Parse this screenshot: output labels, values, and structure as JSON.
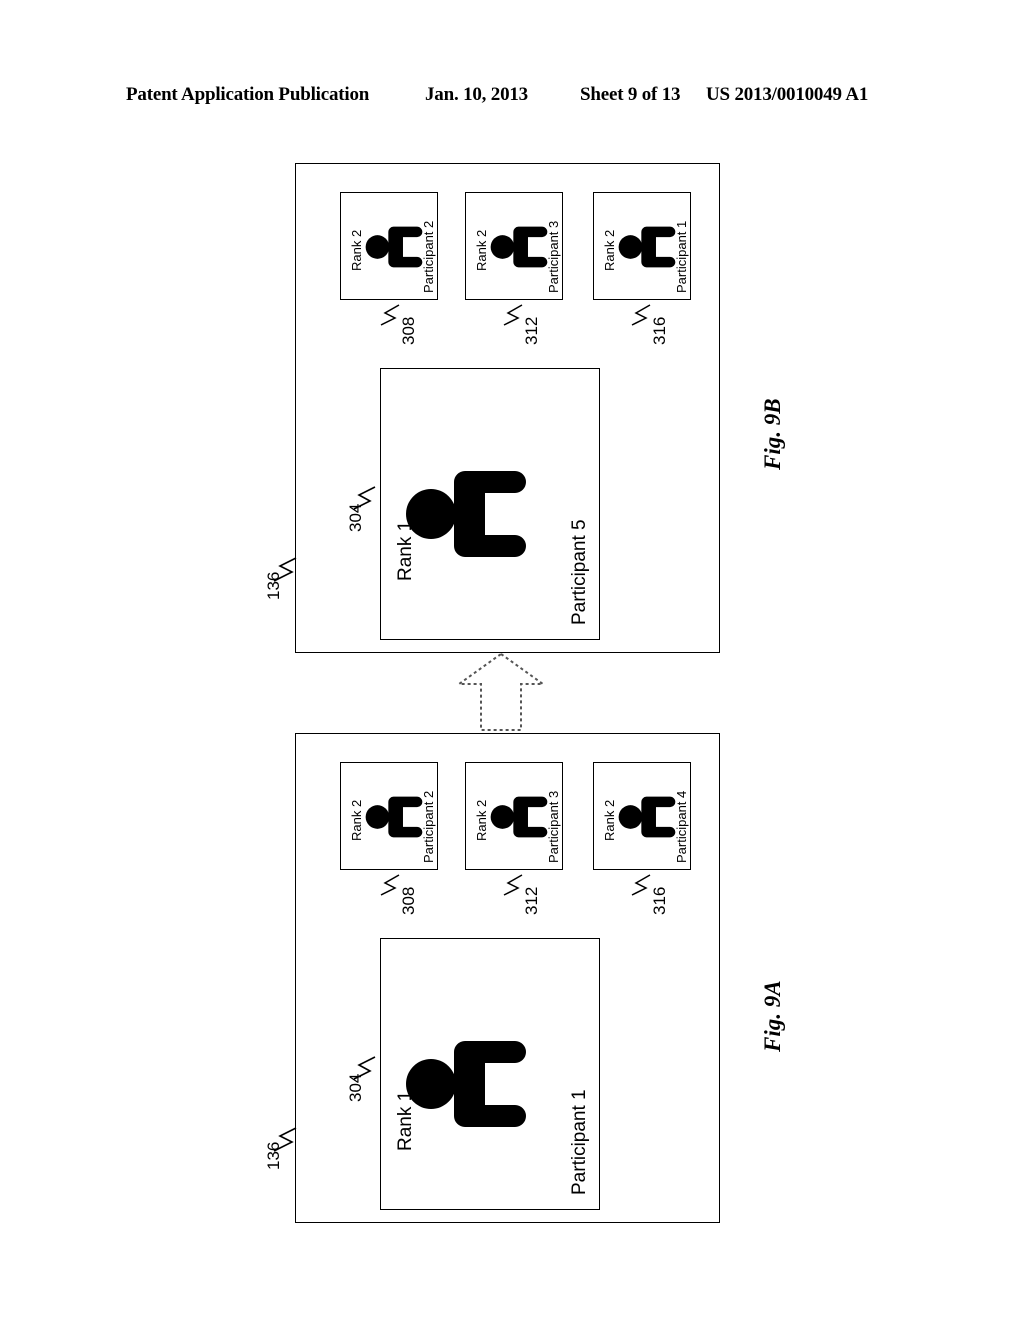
{
  "header": {
    "publication": "Patent Application Publication",
    "date": "Jan. 10, 2013",
    "sheet": "Sheet 9 of 13",
    "number": "US 2013/0010049 A1"
  },
  "figures": [
    {
      "id": "fig9a",
      "caption": "Fig. 9A",
      "container_ref": "136",
      "main_panel": {
        "ref": "304",
        "rank": "Rank 1",
        "participant": "Participant 1",
        "icon": "person-icon"
      },
      "side_panels": [
        {
          "ref": "308",
          "rank": "Rank 2",
          "participant": "Participant 2",
          "icon": "person-icon"
        },
        {
          "ref": "312",
          "rank": "Rank 2",
          "participant": "Participant 3",
          "icon": "person-icon"
        },
        {
          "ref": "316",
          "rank": "Rank 2",
          "participant": "Participant 4",
          "icon": "person-icon"
        }
      ]
    },
    {
      "id": "fig9b",
      "caption": "Fig. 9B",
      "container_ref": "136",
      "main_panel": {
        "ref": "304",
        "rank": "Rank 1",
        "participant": "Participant 5",
        "icon": "person-icon"
      },
      "side_panels": [
        {
          "ref": "308",
          "rank": "Rank 2",
          "participant": "Participant 2",
          "icon": "person-icon"
        },
        {
          "ref": "312",
          "rank": "Rank 2",
          "participant": "Participant 3",
          "icon": "person-icon"
        },
        {
          "ref": "316",
          "rank": "Rank 2",
          "participant": "Participant 1",
          "icon": "person-icon"
        }
      ]
    }
  ],
  "transition": {
    "icon": "up-arrow-icon",
    "style": "dotted-outline"
  },
  "colors": {
    "ink": "#000000",
    "paper": "#ffffff"
  }
}
